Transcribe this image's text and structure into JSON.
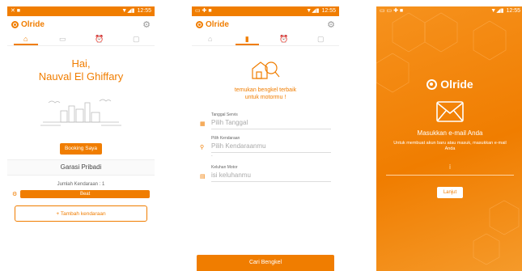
{
  "status_time": "12:55",
  "brand": "Olride",
  "screen1": {
    "greeting_line1": "Hai,",
    "greeting_line2": "Nauval El Ghiffary",
    "booking_button": "Booking Saya",
    "garasi_title": "Garasi Pribadi",
    "jumlah": "Jumlah Kendaraan : 1",
    "vehicle_name": "Beat",
    "add_button": "+ Tambah kendaraan"
  },
  "screen2": {
    "tagline_line1": "temukan bengkel terbaik",
    "tagline_line2": "untuk motormu !",
    "fields": [
      {
        "label": "Tanggal Servis",
        "placeholder": "Pilih Tanggal",
        "hint": ""
      },
      {
        "label": "Pilih Kendaraan",
        "placeholder": "Pilih Kendaraanmu",
        "hint": "-"
      },
      {
        "label": "Keluhan Motor",
        "placeholder": "isi keluhanmu",
        "hint": ""
      }
    ],
    "search_button": "Cari Bengkel"
  },
  "screen3": {
    "title": "Masukkan e-mail Anda",
    "description": "Untuk membuat akun baru atau masuk, masukkan e-mail Anda",
    "next_button": "Lanjut"
  },
  "colors": {
    "primary": "#f07d00",
    "white": "#ffffff"
  },
  "icons": {
    "tabs": [
      "home-icon",
      "book-icon",
      "alarm-icon",
      "chat-icon"
    ],
    "settings": "gear-icon",
    "envelope": "mail-icon"
  }
}
